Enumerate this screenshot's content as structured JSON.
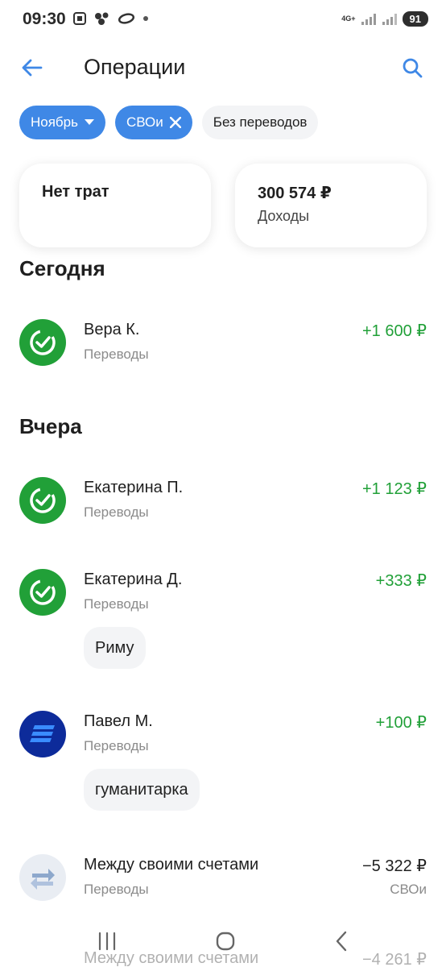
{
  "status_bar": {
    "time": "09:30",
    "network": "4G+",
    "battery": "91"
  },
  "header": {
    "title": "Операции"
  },
  "chips": [
    {
      "label": "Ноябрь"
    },
    {
      "label": "СВОи"
    },
    {
      "label": "Без переводов"
    }
  ],
  "summary": {
    "expenses": {
      "title": "Нет трат"
    },
    "income": {
      "title": "300 574 ₽",
      "subtitle": "Доходы"
    }
  },
  "sections": {
    "today": "Сегодня",
    "yesterday": "Вчера"
  },
  "transactions": [
    {
      "name": "Вера К.",
      "category": "Переводы",
      "amount": "+1 600 ₽",
      "bank_icon": "sber-check-icon"
    },
    {
      "name": "Екатерина П.",
      "category": "Переводы",
      "amount": "+1 123 ₽",
      "bank_icon": "sber-check-icon"
    },
    {
      "name": "Екатерина Д.",
      "category": "Переводы",
      "amount": "+333 ₽",
      "comment": "Риму",
      "bank_icon": "sber-check-icon"
    },
    {
      "name": "Павел М.",
      "category": "Переводы",
      "amount": "+100 ₽",
      "comment": "гуманитарка",
      "bank_icon": "vtb-icon"
    },
    {
      "name": "Между своими счетами",
      "category": "Переводы",
      "amount": "−5 322 ₽",
      "account": "СВОи",
      "bank_icon": "transfer-arrows-icon"
    },
    {
      "name": "Между своими счетами",
      "amount": "−4 261 ₽",
      "bank_icon": "transfer-arrows-icon"
    }
  ],
  "colors": {
    "accent": "#3f88e6",
    "income": "#21a038",
    "sber": "#21a038",
    "vtb": "#0d2b9a"
  }
}
